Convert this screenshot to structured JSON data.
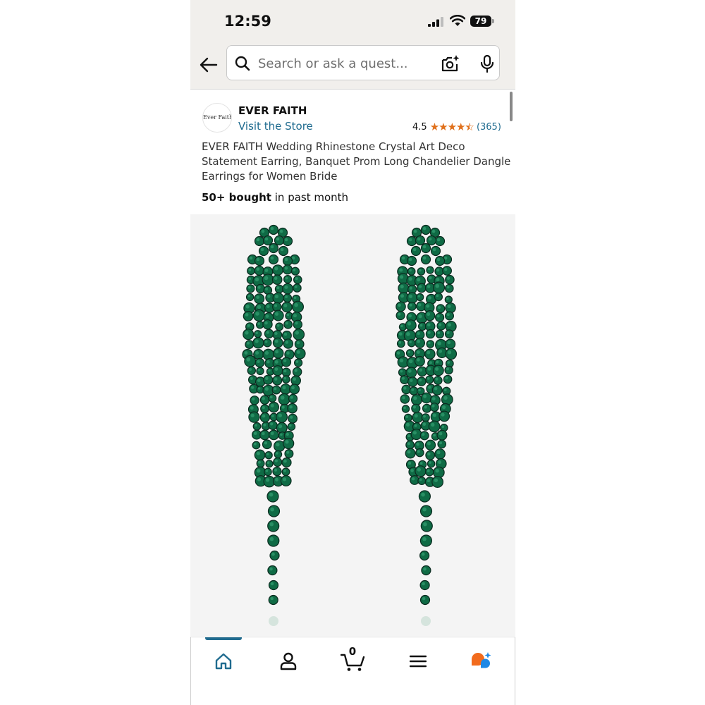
{
  "status_bar": {
    "time": "12:59",
    "battery": "79"
  },
  "search": {
    "placeholder": "Search or ask a quest..."
  },
  "product": {
    "brand_logo_text": "Ever Faith",
    "brand_name": "EVER FAITH",
    "visit_store": "Visit the Store",
    "rating": "4.5",
    "review_count": "(365)",
    "title": "EVER FAITH Wedding Rhinestone Crystal Art Deco Statement Earring, Banquet Prom Long Chandelier Dangle Earrings for Women Bride",
    "bought_bold": "50+ bought",
    "bought_rest": " in past month"
  },
  "bottom_nav": {
    "cart_count": "0"
  },
  "colors": {
    "accent": "#1f6b8f",
    "star": "#e0701b",
    "gem": "#0f6b45"
  },
  "icons": [
    "back-arrow-icon",
    "search-icon",
    "camera-icon",
    "microphone-icon",
    "home-icon",
    "account-icon",
    "cart-icon",
    "menu-icon",
    "ai-assistant-icon"
  ]
}
